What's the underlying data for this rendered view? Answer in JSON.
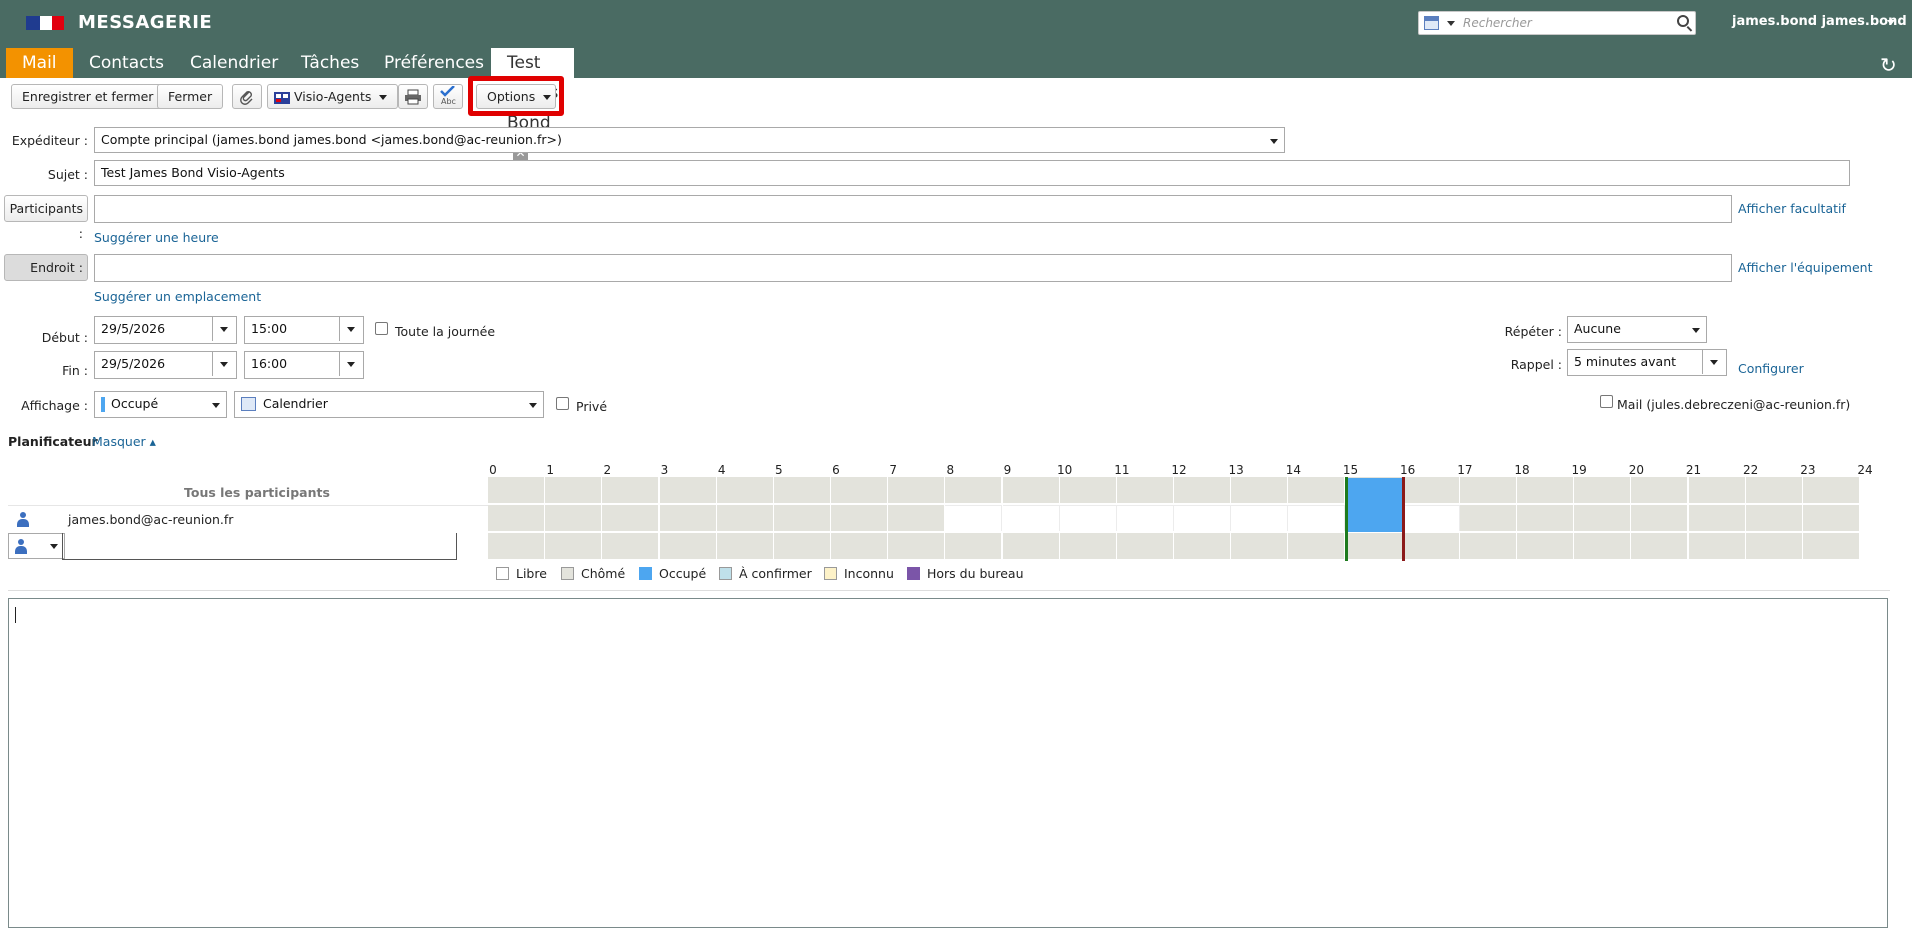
{
  "header": {
    "app_title": "MESSAGERIE",
    "search_placeholder": "Rechercher",
    "user": "james.bond james.bond"
  },
  "tabs": [
    "Mail",
    "Contacts",
    "Calendrier",
    "Tâches",
    "Préférences"
  ],
  "doc_tab": {
    "label": "Test James Bond",
    "close": "✕"
  },
  "toolbar": {
    "save_close": "Enregistrer et fermer",
    "close": "Fermer",
    "visio": "Visio-Agents",
    "options": "Options"
  },
  "form": {
    "sender_label": "Expéditeur :",
    "sender_value": "Compte principal (james.bond james.bond <james.bond@ac-reunion.fr>)",
    "subject_label": "Sujet :",
    "subject_value": "Test James Bond Visio-Agents",
    "participants_label": "Participants :",
    "show_optional": "Afficher facultatif",
    "suggest_time": "Suggérer une heure",
    "location_label": "Endroit :",
    "show_equipment": "Afficher l'équipement",
    "suggest_location": "Suggérer un emplacement",
    "start_label": "Début :",
    "start_date": "29/5/2026",
    "start_time": "15:00",
    "all_day": "Toute la journée",
    "end_label": "Fin :",
    "end_date": "29/5/2026",
    "end_time": "16:00",
    "repeat_label": "Répéter :",
    "repeat_value": "Aucune",
    "reminder_label": "Rappel :",
    "reminder_value": "5 minutes avant",
    "configure": "Configurer",
    "display_label": "Affichage :",
    "display_value": "Occupé",
    "calendar_value": "Calendrier",
    "private": "Privé",
    "mail_label": "Mail (jules.debreczeni@ac-reunion.fr)"
  },
  "planner": {
    "title": "Planificateur",
    "hide": "Masquer",
    "all_participants": "Tous les participants",
    "attendee": "james.bond@ac-reunion.fr",
    "hours": [
      "0",
      "1",
      "2",
      "3",
      "4",
      "5",
      "6",
      "7",
      "8",
      "9",
      "10",
      "11",
      "12",
      "13",
      "14",
      "15",
      "16",
      "17",
      "18",
      "19",
      "20",
      "21",
      "22",
      "23",
      "24"
    ],
    "busy_start_hour": 15,
    "busy_end_hour": 16,
    "attendee_free_from": 8,
    "attendee_free_to": 17,
    "legend": [
      "Libre",
      "Chômé",
      "Occupé",
      "À confirmer",
      "Inconnu",
      "Hors du bureau"
    ],
    "legend_colors": [
      "#ffffff",
      "#e3e3dc",
      "#4da6f0",
      "#bfe0ea",
      "#fdf2c8",
      "#7b55a8"
    ]
  },
  "colors": {
    "header": "#4a6b63",
    "accent": "#f39200",
    "link": "#1a6496",
    "highlight": "#e00000"
  }
}
